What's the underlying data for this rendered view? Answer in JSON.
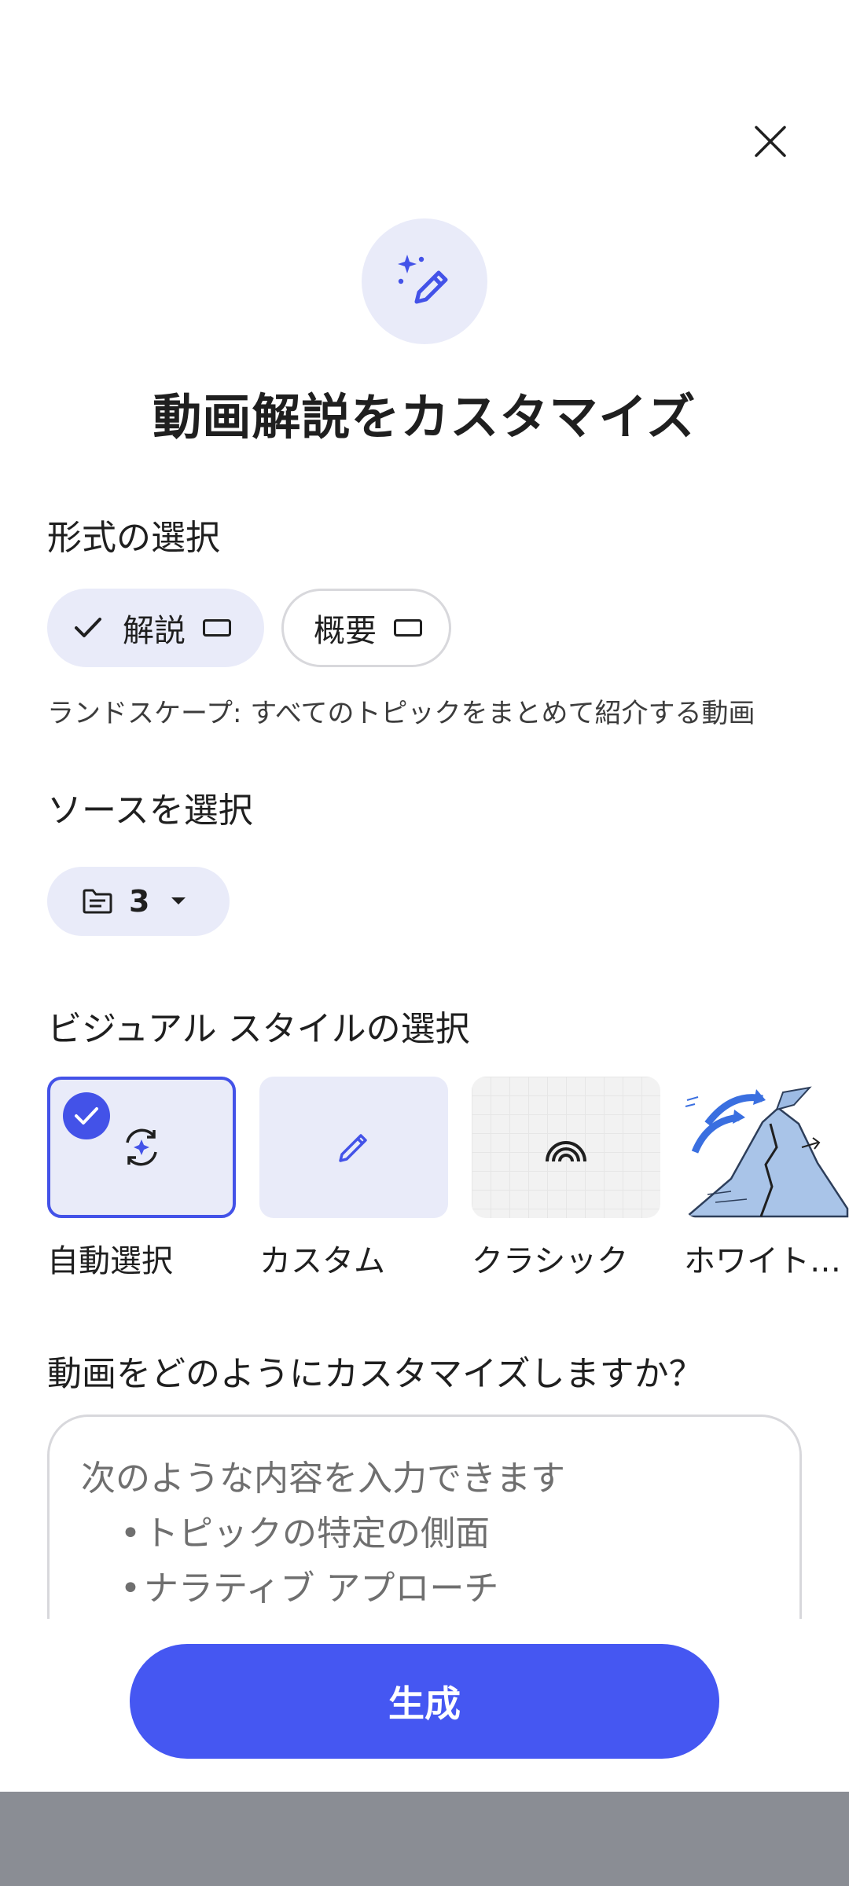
{
  "title": "動画解説をカスタマイズ",
  "format_section": {
    "label": "形式の選択",
    "options": [
      {
        "label": "解説",
        "selected": true
      },
      {
        "label": "概要",
        "selected": false
      }
    ],
    "description": "ランドスケープ: すべてのトピックをまとめて紹介する動画"
  },
  "source_section": {
    "label": "ソースを選択",
    "count": "3"
  },
  "visual_style_section": {
    "label": "ビジュアル スタイルの選択",
    "styles": [
      {
        "label": "自動選択",
        "icon": "auto-select-icon",
        "selected": true
      },
      {
        "label": "カスタム",
        "icon": "pencil-icon",
        "selected": false
      },
      {
        "label": "クラシック",
        "icon": "rainbow-icon",
        "selected": false
      },
      {
        "label": "ホワイト…",
        "icon": "volcano-illustration",
        "selected": false
      }
    ]
  },
  "customize_section": {
    "label": "動画をどのようにカスタマイズしますか？",
    "placeholder_intro": "次のような内容を入力できます",
    "placeholder_bullets": [
      "トピックの特定の側面",
      "ナラティブ アプローチ"
    ]
  },
  "generate_button": "生成",
  "colors": {
    "accent": "#4557f2",
    "chip_bg": "#e9ebf9",
    "selected_border": "#4352e8"
  }
}
